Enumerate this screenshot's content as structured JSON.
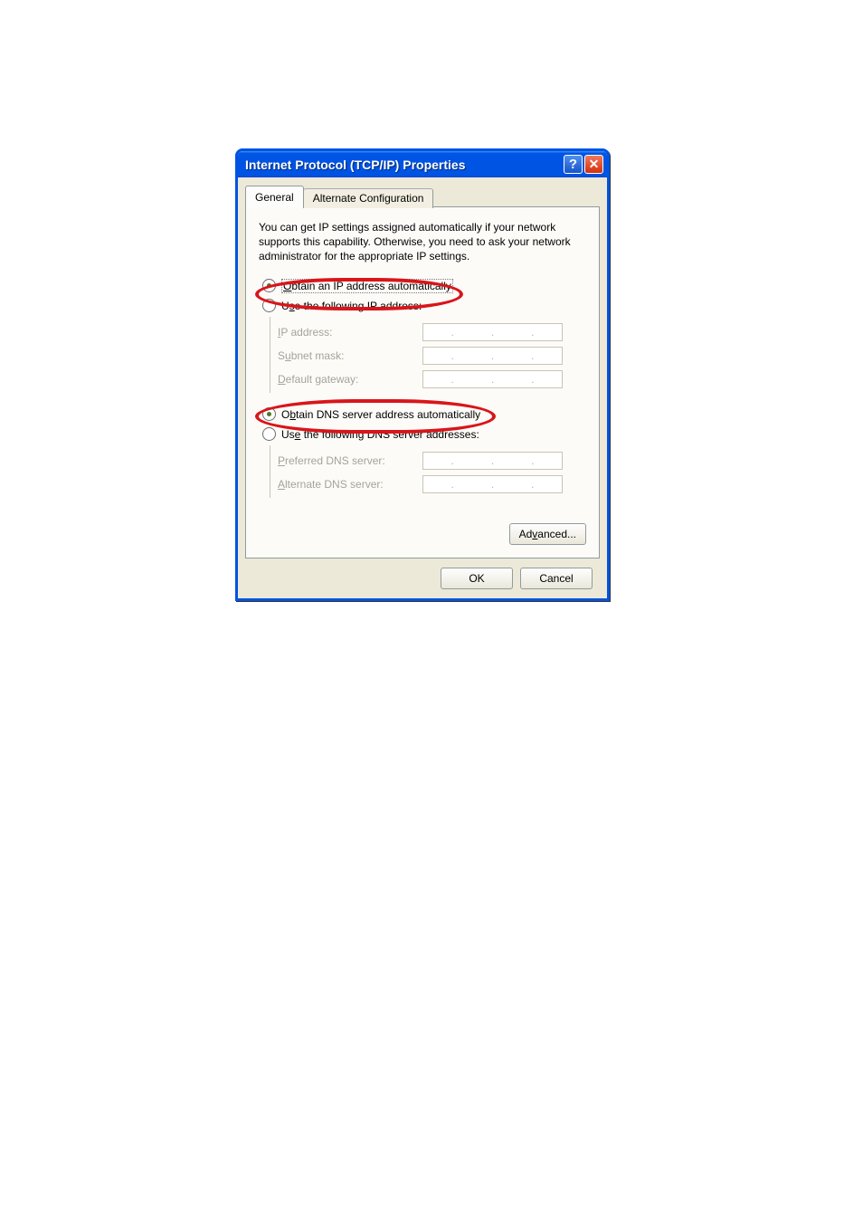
{
  "titlebar": {
    "title": "Internet Protocol (TCP/IP) Properties",
    "help_symbol": "?",
    "close_symbol": "✕"
  },
  "tabs": {
    "general": "General",
    "alternate": "Alternate Configuration"
  },
  "description": "You can get IP settings assigned automatically if your network supports this capability. Otherwise, you need to ask your network administrator for the appropriate IP settings.",
  "ip_section": {
    "auto_prefix": "O",
    "auto_rest": "btain an IP address automatically",
    "manual_prefix": "U",
    "manual_mn": "s",
    "manual_rest": "e the following IP address:",
    "ip_address_mn": "I",
    "ip_address_rest": "P address:",
    "subnet_prefix": "S",
    "subnet_mn": "u",
    "subnet_rest": "bnet mask:",
    "gateway_mn": "D",
    "gateway_rest": "efault gateway:"
  },
  "dns_section": {
    "auto_prefix": "O",
    "auto_mn": "b",
    "auto_rest": "tain DNS server address automatically",
    "manual_prefix": "Us",
    "manual_mn": "e",
    "manual_rest": " the following DNS server addresses:",
    "pref_mn": "P",
    "pref_rest": "referred DNS server:",
    "alt_mn": "A",
    "alt_rest": "lternate DNS server:"
  },
  "buttons": {
    "advanced_prefix": "Ad",
    "advanced_mn": "v",
    "advanced_rest": "anced...",
    "ok": "OK",
    "cancel": "Cancel"
  },
  "ip_dot": "."
}
